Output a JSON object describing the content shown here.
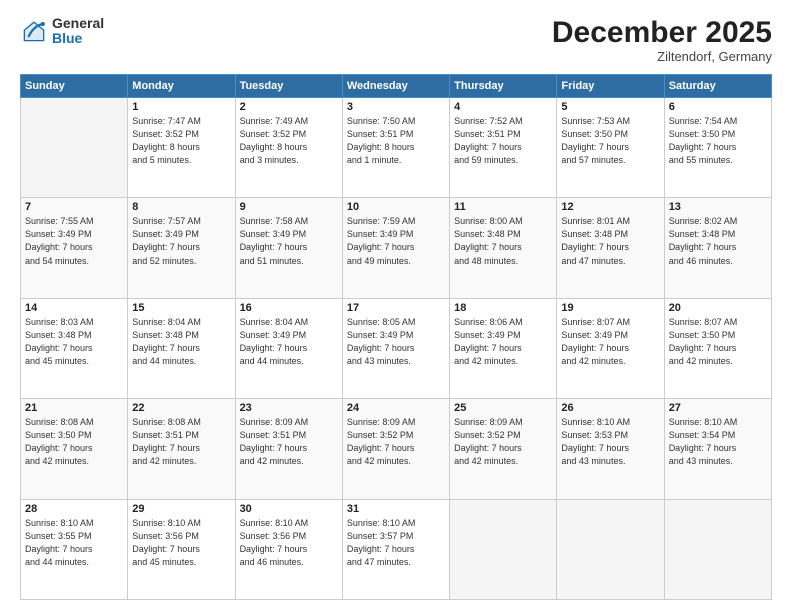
{
  "logo": {
    "general": "General",
    "blue": "Blue"
  },
  "header": {
    "month": "December 2025",
    "location": "Ziltendorf, Germany"
  },
  "weekdays": [
    "Sunday",
    "Monday",
    "Tuesday",
    "Wednesday",
    "Thursday",
    "Friday",
    "Saturday"
  ],
  "weeks": [
    [
      {
        "day": "",
        "info": ""
      },
      {
        "day": "1",
        "info": "Sunrise: 7:47 AM\nSunset: 3:52 PM\nDaylight: 8 hours\nand 5 minutes."
      },
      {
        "day": "2",
        "info": "Sunrise: 7:49 AM\nSunset: 3:52 PM\nDaylight: 8 hours\nand 3 minutes."
      },
      {
        "day": "3",
        "info": "Sunrise: 7:50 AM\nSunset: 3:51 PM\nDaylight: 8 hours\nand 1 minute."
      },
      {
        "day": "4",
        "info": "Sunrise: 7:52 AM\nSunset: 3:51 PM\nDaylight: 7 hours\nand 59 minutes."
      },
      {
        "day": "5",
        "info": "Sunrise: 7:53 AM\nSunset: 3:50 PM\nDaylight: 7 hours\nand 57 minutes."
      },
      {
        "day": "6",
        "info": "Sunrise: 7:54 AM\nSunset: 3:50 PM\nDaylight: 7 hours\nand 55 minutes."
      }
    ],
    [
      {
        "day": "7",
        "info": "Sunrise: 7:55 AM\nSunset: 3:49 PM\nDaylight: 7 hours\nand 54 minutes."
      },
      {
        "day": "8",
        "info": "Sunrise: 7:57 AM\nSunset: 3:49 PM\nDaylight: 7 hours\nand 52 minutes."
      },
      {
        "day": "9",
        "info": "Sunrise: 7:58 AM\nSunset: 3:49 PM\nDaylight: 7 hours\nand 51 minutes."
      },
      {
        "day": "10",
        "info": "Sunrise: 7:59 AM\nSunset: 3:49 PM\nDaylight: 7 hours\nand 49 minutes."
      },
      {
        "day": "11",
        "info": "Sunrise: 8:00 AM\nSunset: 3:48 PM\nDaylight: 7 hours\nand 48 minutes."
      },
      {
        "day": "12",
        "info": "Sunrise: 8:01 AM\nSunset: 3:48 PM\nDaylight: 7 hours\nand 47 minutes."
      },
      {
        "day": "13",
        "info": "Sunrise: 8:02 AM\nSunset: 3:48 PM\nDaylight: 7 hours\nand 46 minutes."
      }
    ],
    [
      {
        "day": "14",
        "info": "Sunrise: 8:03 AM\nSunset: 3:48 PM\nDaylight: 7 hours\nand 45 minutes."
      },
      {
        "day": "15",
        "info": "Sunrise: 8:04 AM\nSunset: 3:48 PM\nDaylight: 7 hours\nand 44 minutes."
      },
      {
        "day": "16",
        "info": "Sunrise: 8:04 AM\nSunset: 3:49 PM\nDaylight: 7 hours\nand 44 minutes."
      },
      {
        "day": "17",
        "info": "Sunrise: 8:05 AM\nSunset: 3:49 PM\nDaylight: 7 hours\nand 43 minutes."
      },
      {
        "day": "18",
        "info": "Sunrise: 8:06 AM\nSunset: 3:49 PM\nDaylight: 7 hours\nand 42 minutes."
      },
      {
        "day": "19",
        "info": "Sunrise: 8:07 AM\nSunset: 3:49 PM\nDaylight: 7 hours\nand 42 minutes."
      },
      {
        "day": "20",
        "info": "Sunrise: 8:07 AM\nSunset: 3:50 PM\nDaylight: 7 hours\nand 42 minutes."
      }
    ],
    [
      {
        "day": "21",
        "info": "Sunrise: 8:08 AM\nSunset: 3:50 PM\nDaylight: 7 hours\nand 42 minutes."
      },
      {
        "day": "22",
        "info": "Sunrise: 8:08 AM\nSunset: 3:51 PM\nDaylight: 7 hours\nand 42 minutes."
      },
      {
        "day": "23",
        "info": "Sunrise: 8:09 AM\nSunset: 3:51 PM\nDaylight: 7 hours\nand 42 minutes."
      },
      {
        "day": "24",
        "info": "Sunrise: 8:09 AM\nSunset: 3:52 PM\nDaylight: 7 hours\nand 42 minutes."
      },
      {
        "day": "25",
        "info": "Sunrise: 8:09 AM\nSunset: 3:52 PM\nDaylight: 7 hours\nand 42 minutes."
      },
      {
        "day": "26",
        "info": "Sunrise: 8:10 AM\nSunset: 3:53 PM\nDaylight: 7 hours\nand 43 minutes."
      },
      {
        "day": "27",
        "info": "Sunrise: 8:10 AM\nSunset: 3:54 PM\nDaylight: 7 hours\nand 43 minutes."
      }
    ],
    [
      {
        "day": "28",
        "info": "Sunrise: 8:10 AM\nSunset: 3:55 PM\nDaylight: 7 hours\nand 44 minutes."
      },
      {
        "day": "29",
        "info": "Sunrise: 8:10 AM\nSunset: 3:56 PM\nDaylight: 7 hours\nand 45 minutes."
      },
      {
        "day": "30",
        "info": "Sunrise: 8:10 AM\nSunset: 3:56 PM\nDaylight: 7 hours\nand 46 minutes."
      },
      {
        "day": "31",
        "info": "Sunrise: 8:10 AM\nSunset: 3:57 PM\nDaylight: 7 hours\nand 47 minutes."
      },
      {
        "day": "",
        "info": ""
      },
      {
        "day": "",
        "info": ""
      },
      {
        "day": "",
        "info": ""
      }
    ]
  ]
}
